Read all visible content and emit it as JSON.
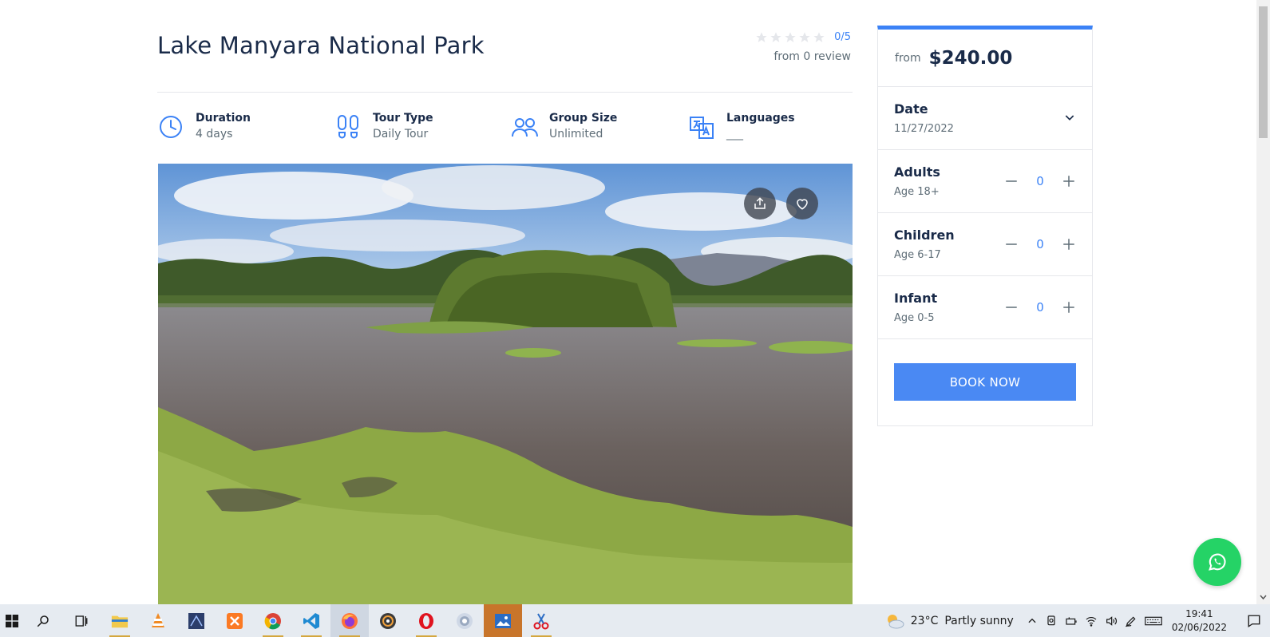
{
  "tour": {
    "title": "Lake Manyara National Park",
    "rating_score": "0/5",
    "rating_value": 0,
    "rating_max": 5,
    "reviews": "from 0 review"
  },
  "features": [
    {
      "icon": "clock-icon",
      "label": "Duration",
      "value": "4 days"
    },
    {
      "icon": "footprints-icon",
      "label": "Tour Type",
      "value": "Daily Tour"
    },
    {
      "icon": "group-icon",
      "label": "Group Size",
      "value": "Unlimited"
    },
    {
      "icon": "translate-icon",
      "label": "Languages",
      "value": "___"
    }
  ],
  "hero": {
    "share_icon": "share-icon",
    "wishlist_icon": "heart-icon"
  },
  "booking": {
    "from_label": "from",
    "price": "$240.00",
    "date_label": "Date",
    "date_value": "11/27/2022",
    "guests": [
      {
        "label": "Adults",
        "sub": "Age 18+",
        "qty": "0"
      },
      {
        "label": "Children",
        "sub": "Age 6-17",
        "qty": "0"
      },
      {
        "label": "Infant",
        "sub": "Age 0-5",
        "qty": "0"
      }
    ],
    "book_label": "BOOK NOW"
  },
  "colors": {
    "accent": "#3b82f6",
    "button": "#4a89f3",
    "whatsapp": "#25d366",
    "text_dark": "#1a2b49"
  },
  "taskbar": {
    "apps": [
      "start-icon",
      "search-icon",
      "task-view-icon",
      "file-explorer-icon",
      "vlc-icon",
      "app-icon",
      "xampp-icon",
      "chrome-icon",
      "vscode-icon",
      "firefox-icon",
      "media-icon",
      "opera-icon",
      "app-icon-2",
      "photos-icon",
      "snipping-tool-icon"
    ],
    "weather_temp": "23°C",
    "weather_text": "Partly sunny",
    "time": "19:41",
    "date": "02/06/2022"
  }
}
